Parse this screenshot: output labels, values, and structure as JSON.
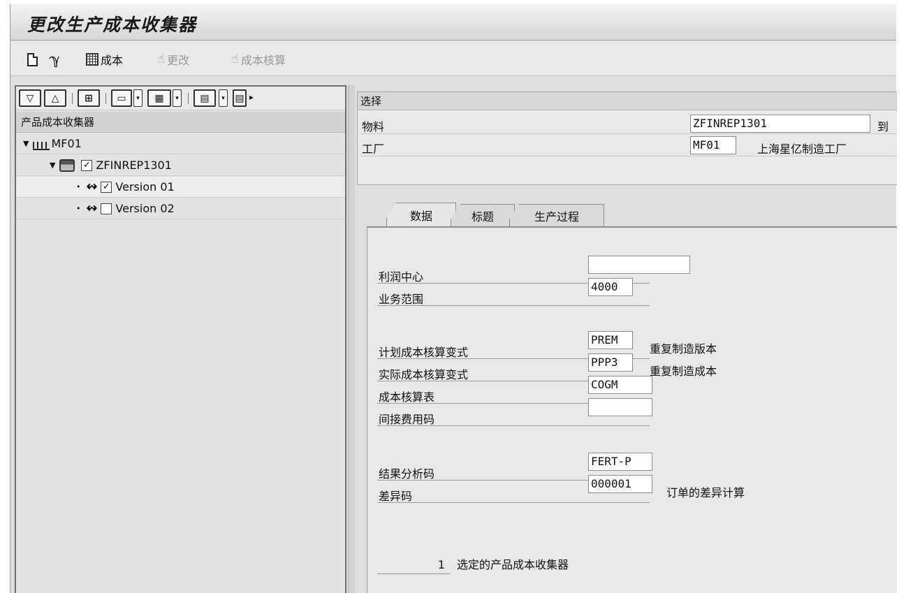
{
  "window": {
    "title": "更改生产成本收集器"
  },
  "toolbar": {
    "cost_label": "成本",
    "change_label": "更改",
    "costing_label": "成本核算"
  },
  "tree": {
    "header": "产品成本收集器",
    "plant": "MF01",
    "collector": "ZFINREP1301",
    "versions": [
      {
        "label": "Version 01",
        "checked": true
      },
      {
        "label": "Version 02",
        "checked": false
      }
    ],
    "collector_checked": true
  },
  "selection": {
    "title": "选择",
    "material_label": "物料",
    "material_value": "ZFINREP1301",
    "to_label": "到",
    "plant_label": "工厂",
    "plant_value": "MF01",
    "plant_desc": "上海星亿制造工厂"
  },
  "tabs": [
    {
      "label": "数据",
      "active": true
    },
    {
      "label": "标题",
      "active": false
    },
    {
      "label": "生产过程",
      "active": false
    }
  ],
  "data_tab": {
    "profit_center_label": "利润中心",
    "profit_center_value": "",
    "business_area_label": "业务范围",
    "business_area_value": "4000",
    "planned_variant_label": "计划成本核算变式",
    "planned_variant_value": "PREM",
    "planned_variant_desc": "重复制造版本",
    "actual_variant_label": "实际成本核算变式",
    "actual_variant_value": "PPP3",
    "actual_variant_desc": "重复制造成本",
    "costing_sheet_label": "成本核算表",
    "costing_sheet_value": "COGM",
    "overhead_key_label": "间接费用码",
    "overhead_key_value": "",
    "ra_key_label": "结果分析码",
    "ra_key_value": "FERT-P",
    "variance_key_label": "差异码",
    "variance_key_value": "000001",
    "variance_key_desc": "订单的差异计算",
    "selected_count": "1",
    "selected_text": "选定的产品成本收集器"
  },
  "icons": {
    "new": "new-document-icon",
    "display": "display-glasses-icon",
    "cost": "calculator-icon",
    "change": "change-hand-icon",
    "costing": "costing-hand-icon"
  }
}
